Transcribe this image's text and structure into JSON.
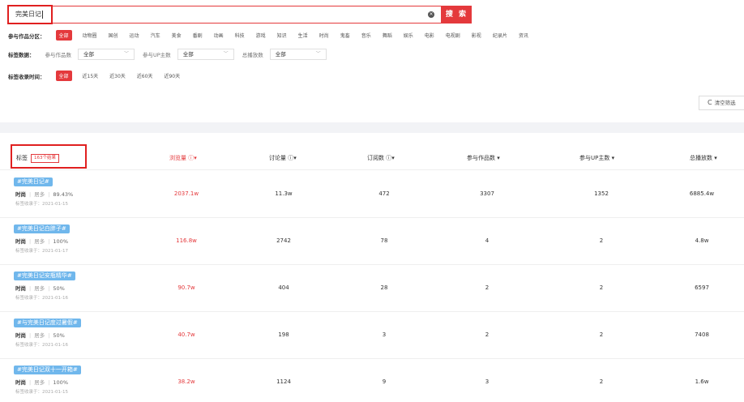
{
  "search": {
    "query": "完美日记",
    "button_label": "搜 索",
    "clear_icon": "×"
  },
  "filters": {
    "zone": {
      "label": "参与作品分区：",
      "options": [
        "全部",
        "动物圈",
        "国创",
        "运动",
        "汽车",
        "美食",
        "番剧",
        "动画",
        "科技",
        "游戏",
        "知识",
        "生活",
        "时尚",
        "鬼畜",
        "音乐",
        "舞蹈",
        "娱乐",
        "电影",
        "电视剧",
        "影视",
        "纪录片",
        "资讯"
      ],
      "active": "全部"
    },
    "data": {
      "label": "标签数据：",
      "works_label": "参与作品数",
      "works_value": "全部",
      "up_label": "参与UP主数",
      "up_value": "全部",
      "plays_label": "总播放数",
      "plays_value": "全部"
    },
    "time": {
      "label": "标签收录时间：",
      "options": [
        "全部",
        "近15天",
        "近30天",
        "近60天",
        "近90天"
      ],
      "active": "全部"
    },
    "clear_label": "清空筛选"
  },
  "table": {
    "headers": {
      "tag": "标签",
      "result_count": "163个结果",
      "views": "浏览量 ⓘ▾",
      "discussions": "讨论量 ⓘ▾",
      "subscriptions": "订阅数 ⓘ▾",
      "works": "参与作品数 ▾",
      "ups": "参与UP主数 ▾",
      "plays": "总播放数 ▾"
    },
    "rows": [
      {
        "tag": "#完美日记#",
        "category": "时尚",
        "level": "居多",
        "percent": "89.43%",
        "added": "标签收录于：2021-01-15",
        "views": "2037.1w",
        "discussions": "11.3w",
        "subscriptions": "472",
        "works": "3307",
        "ups": "1352",
        "plays": "6885.4w"
      },
      {
        "tag": "#完美日记白胖子#",
        "category": "时尚",
        "level": "居多",
        "percent": "100%",
        "added": "标签收录于：2021-01-17",
        "views": "116.8w",
        "discussions": "2742",
        "subscriptions": "78",
        "works": "4",
        "ups": "2",
        "plays": "4.8w"
      },
      {
        "tag": "#完美日记安瓶精华#",
        "category": "时尚",
        "level": "居多",
        "percent": "50%",
        "added": "标签收录于：2021-01-16",
        "views": "90.7w",
        "discussions": "404",
        "subscriptions": "28",
        "works": "2",
        "ups": "2",
        "plays": "6597"
      },
      {
        "tag": "#与完美日记度过暑假#",
        "category": "时尚",
        "level": "居多",
        "percent": "50%",
        "added": "标签收录于：2021-01-16",
        "views": "40.7w",
        "discussions": "198",
        "subscriptions": "3",
        "works": "2",
        "ups": "2",
        "plays": "7408"
      },
      {
        "tag": "#完美日记双十一开箱#",
        "category": "时尚",
        "level": "居多",
        "percent": "100%",
        "added": "标签收录于：2021-01-15",
        "views": "38.2w",
        "discussions": "1124",
        "subscriptions": "9",
        "works": "3",
        "ups": "2",
        "plays": "1.6w"
      }
    ]
  },
  "colors": {
    "accent": "#e4393c",
    "tag_pill": "#70b7ec",
    "band": "#f2f3f6"
  }
}
